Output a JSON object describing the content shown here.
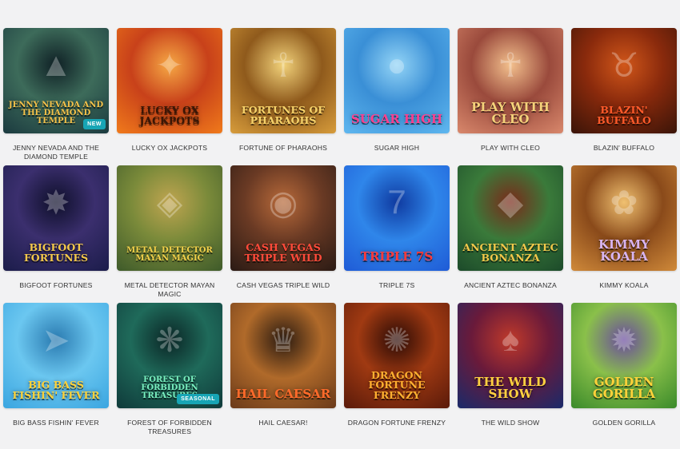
{
  "games": [
    {
      "title": "JENNY NEVADA AND THE DIAMOND TEMPLE",
      "logo": "Jenny Nevada and the Diamond Temple",
      "badge": "NEW",
      "icon": "pyramid-icon",
      "colors": [
        "#1b3a3f",
        "#3d6b5a",
        "#0f2025"
      ],
      "logo_color": "#f5c24a"
    },
    {
      "title": "LUCKY OX JACKPOTS",
      "logo": "Lucky Ox Jackpots",
      "badge": "",
      "icon": "ox-icon",
      "colors": [
        "#f07a1b",
        "#c8411a",
        "#f6a845"
      ],
      "logo_color": "#3a1605"
    },
    {
      "title": "FORTUNE OF PHARAOHS",
      "logo": "Fortunes of Pharaohs",
      "badge": "",
      "icon": "pharaoh-icon",
      "colors": [
        "#d79c3b",
        "#8f5a1c",
        "#f2d27a"
      ],
      "logo_color": "#f6d26a"
    },
    {
      "title": "SUGAR HIGH",
      "logo": "Sugar High",
      "badge": "",
      "icon": "candy-icon",
      "colors": [
        "#5fb7ef",
        "#3a8fd6",
        "#93d4f6"
      ],
      "logo_color": "#ff3f8e"
    },
    {
      "title": "PLAY WITH CLEO",
      "logo": "Play with Cleo",
      "badge": "",
      "icon": "cleopatra-icon",
      "colors": [
        "#d9886c",
        "#9a4a3c",
        "#f3c08d"
      ],
      "logo_color": "#f4d27a"
    },
    {
      "title": "BLAZIN' BUFFALO",
      "logo": "Blazin' Buffalo",
      "badge": "",
      "icon": "buffalo-icon",
      "colors": [
        "#3a1408",
        "#8a2a0c",
        "#d1571a"
      ],
      "logo_color": "#ff5a2a"
    },
    {
      "title": "BIGFOOT FORTUNES",
      "logo": "Bigfoot Fortunes",
      "badge": "",
      "icon": "bigfoot-icon",
      "colors": [
        "#1b1c4a",
        "#3b2f6e",
        "#0e0f2a"
      ],
      "logo_color": "#f3c84a"
    },
    {
      "title": "METAL DETECTOR MAYAN MAGIC",
      "logo": "Metal Detector Mayan Magic",
      "badge": "",
      "icon": "mayan-mask-icon",
      "colors": [
        "#3e5a2a",
        "#7a8a3a",
        "#c0a550"
      ],
      "logo_color": "#f2d04a"
    },
    {
      "title": "CASH VEGAS TRIPLE WILD",
      "logo": "Cash Vegas Triple Wild",
      "badge": "",
      "icon": "chip-icon",
      "colors": [
        "#2a1a14",
        "#6a3a24",
        "#b86a3a"
      ],
      "logo_color": "#ff4a3a"
    },
    {
      "title": "TRIPLE 7S",
      "logo": "Triple 7s",
      "badge": "",
      "icon": "seven-icon",
      "colors": [
        "#1f5bd6",
        "#2f86ea",
        "#0f3aa0"
      ],
      "logo_color": "#ff3a3a"
    },
    {
      "title": "ANCIENT AZTEC BONANZA",
      "logo": "Ancient Aztec Bonanza",
      "badge": "",
      "icon": "aztec-icon",
      "colors": [
        "#1c4a2a",
        "#3a7a3a",
        "#7a2a1a"
      ],
      "logo_color": "#f3c84a"
    },
    {
      "title": "KIMMY KOALA",
      "logo": "Kimmy Koala",
      "badge": "",
      "icon": "koala-icon",
      "colors": [
        "#d08a3a",
        "#8a4a1a",
        "#f0c070"
      ],
      "logo_color": "#d8b4f0"
    },
    {
      "title": "BIG BASS FISHIN' FEVER",
      "logo": "Big Bass Fishin' Fever",
      "badge": "",
      "icon": "fish-icon",
      "colors": [
        "#3aa5e0",
        "#6bc7f0",
        "#2a7ab0"
      ],
      "logo_color": "#ffd23a"
    },
    {
      "title": "FOREST OF FORBIDDEN TREASURES",
      "logo": "Forest of Forbidden Treasures",
      "badge": "SEASONAL",
      "icon": "fairy-icon",
      "colors": [
        "#0f3a3a",
        "#1f6a5a",
        "#0a2525"
      ],
      "logo_color": "#7af0c0"
    },
    {
      "title": "HAIL CAESAR!",
      "logo": "Hail Caesar",
      "badge": "",
      "icon": "caesar-icon",
      "colors": [
        "#6a3a1a",
        "#b06a2a",
        "#2a1a10"
      ],
      "logo_color": "#ff6a2a"
    },
    {
      "title": "DRAGON FORTUNE FRENZY",
      "logo": "Dragon Fortune Frenzy",
      "badge": "",
      "icon": "dragon-icon",
      "colors": [
        "#5a1a0a",
        "#a03a12",
        "#2a0a05"
      ],
      "logo_color": "#ffb030"
    },
    {
      "title": "THE WILD SHOW",
      "logo": "The Wild Show",
      "badge": "",
      "icon": "showgirl-icon",
      "colors": [
        "#1a2a6a",
        "#6a1a3a",
        "#c03a2a"
      ],
      "logo_color": "#ffd040"
    },
    {
      "title": "GOLDEN GORILLA",
      "logo": "Golden Gorilla",
      "badge": "",
      "icon": "gorilla-icon",
      "colors": [
        "#3a8a2a",
        "#8ac04a",
        "#6a4aa0"
      ],
      "logo_color": "#ffd23a"
    }
  ]
}
